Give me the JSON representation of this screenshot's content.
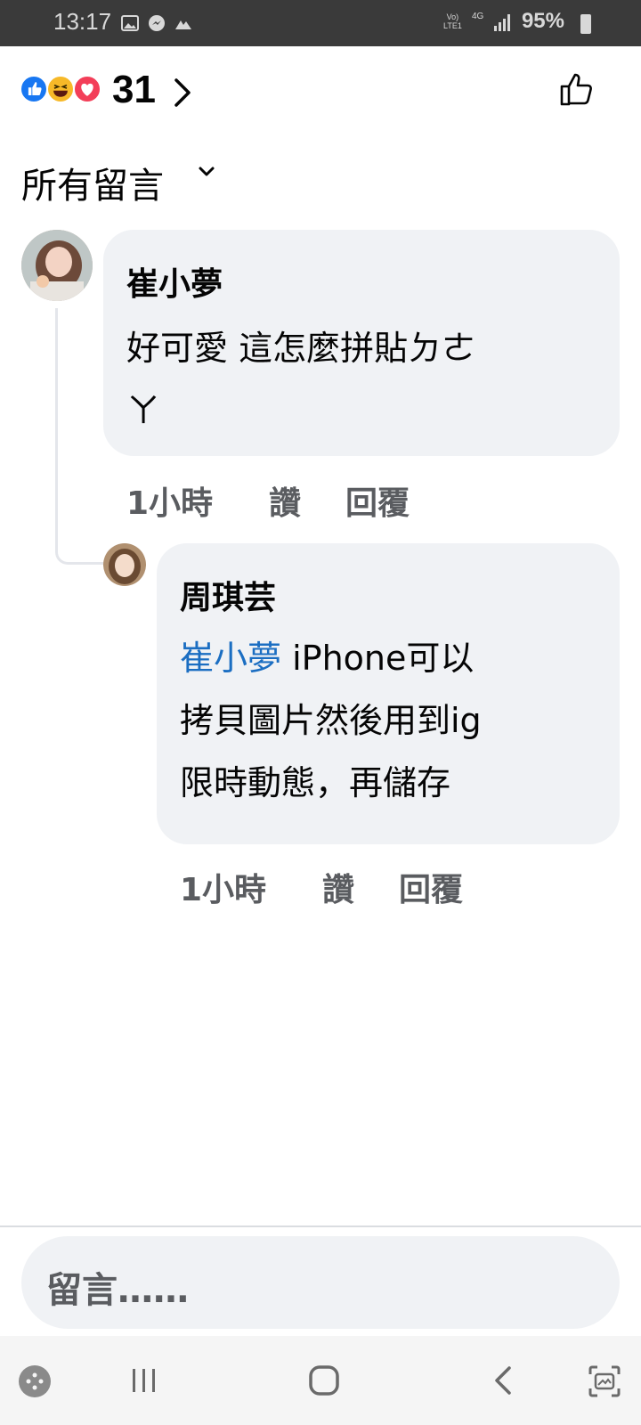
{
  "status_bar": {
    "time": "13:17",
    "network_line1": "Vo)",
    "network_line2": "LTE1",
    "network_type": "4G",
    "battery": "95%"
  },
  "reactions": {
    "count": "31",
    "types": [
      "like-icon",
      "haha-icon",
      "love-icon"
    ],
    "colors": {
      "like": "#1877f2",
      "haha": "#f7b928",
      "love": "#f33e58"
    }
  },
  "filter": {
    "label": "所有留言"
  },
  "comments": [
    {
      "author": "崔小夢",
      "text_line1": "好可愛 這怎麼拼貼ㄉㄜ",
      "text_line2": "ㄚ",
      "time": "1小時",
      "like_label": "讚",
      "reply_label": "回覆"
    }
  ],
  "reply": {
    "author": "周琪芸",
    "mention": "崔小夢",
    "text_line1": " iPhone可以",
    "text_line2": "拷貝圖片然後用到ig",
    "text_line3": "限時動態，再儲存",
    "time": "1小時",
    "like_label": "讚",
    "reply_label": "回覆"
  },
  "composer": {
    "placeholder": "留言……"
  },
  "colors": {
    "mention": "#1b6ec2",
    "bubble": "#f0f2f5",
    "meta": "#5a5c60"
  }
}
